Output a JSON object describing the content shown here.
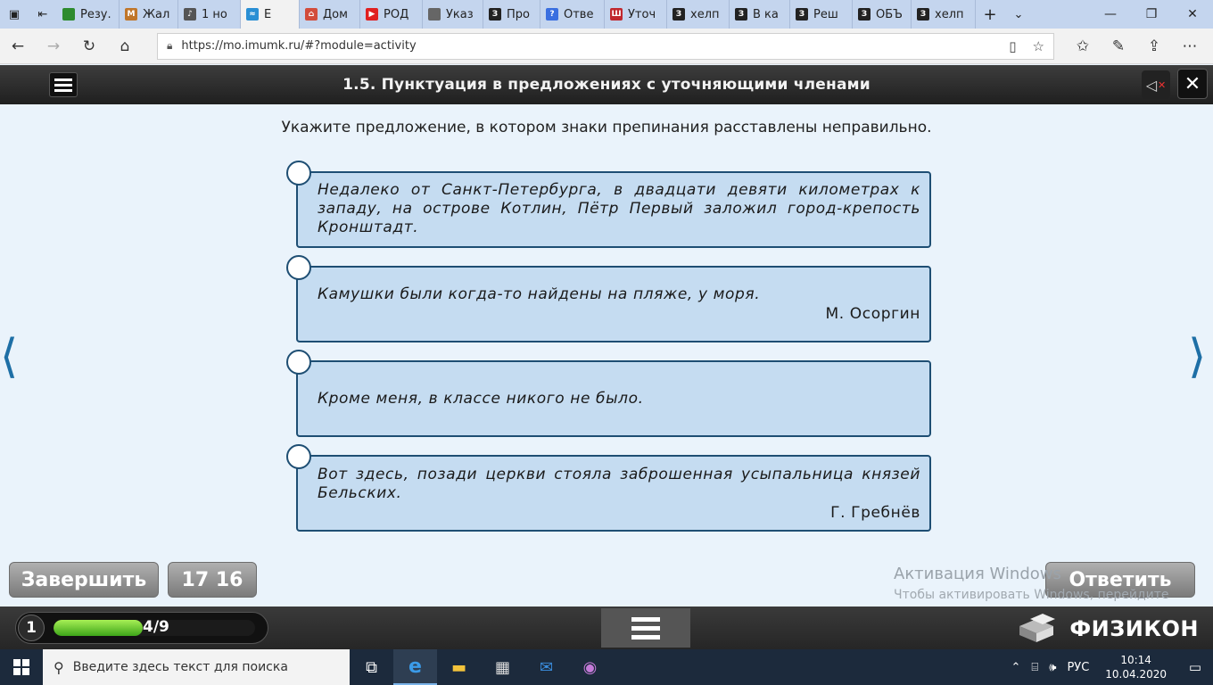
{
  "browser": {
    "tabs": [
      {
        "label": "Резу.",
        "color": "#2e8b2e",
        "glyph": ""
      },
      {
        "label": "Жал",
        "color": "#c0762a",
        "glyph": "M"
      },
      {
        "label": "1 но",
        "color": "#555555",
        "glyph": "♪"
      },
      {
        "label": "Е",
        "color": "#2a8fd4",
        "glyph": "≈"
      },
      {
        "label": "Дом",
        "color": "#d24c3b",
        "glyph": "⌂"
      },
      {
        "label": "РОД",
        "color": "#e02020",
        "glyph": "▶"
      },
      {
        "label": "Указ",
        "color": "#666666",
        "glyph": ""
      },
      {
        "label": "Про",
        "color": "#222222",
        "glyph": "З"
      },
      {
        "label": "Отве",
        "color": "#3a6fe0",
        "glyph": "?"
      },
      {
        "label": "Уточ",
        "color": "#c0282e",
        "glyph": "Ш"
      },
      {
        "label": "хелп",
        "color": "#222222",
        "glyph": "З"
      },
      {
        "label": "В ка",
        "color": "#222222",
        "glyph": "З"
      },
      {
        "label": "Реш",
        "color": "#222222",
        "glyph": "З"
      },
      {
        "label": "ОБЪ",
        "color": "#222222",
        "glyph": "З"
      },
      {
        "label": "хелп",
        "color": "#222222",
        "glyph": "З"
      }
    ],
    "url": "https://mo.imumk.ru/#?module=activity"
  },
  "app": {
    "title": "1.5. Пунктуация в предложениях с уточняющими членами",
    "question": "Укажите предложение, в котором знаки препинания расставлены неправильно.",
    "options": [
      {
        "text": "Недалеко от Санкт-Петербурга, в двадцати девяти километрах к западу, на острове Котлин, Пётр Первый заложил город-крепость Кронштадт.",
        "author": ""
      },
      {
        "text": "Камушки были когда-то найдены на пляже, у моря.",
        "author": "М. Осоргин"
      },
      {
        "text": "Кроме меня, в классе никого не было.",
        "author": ""
      },
      {
        "text": "Вот здесь, позади церкви стояла заброшенная усыпальница князей Бельских.",
        "author": "Г. Гребнёв"
      }
    ],
    "finish_label": "Завершить",
    "timer_label": "17 16",
    "answer_label": "Ответить",
    "progress": {
      "step": "1",
      "label": "4/9",
      "fraction": 0.444
    },
    "brand": "ФИЗИКОН"
  },
  "watermark": {
    "line1": "Активация Windows",
    "line2": "Чтобы активировать Windows, перейдите в раздел \"Параметры\"."
  },
  "taskbar": {
    "search_placeholder": "Введите здесь текст для поиска",
    "lang": "РУС",
    "time": "10:14",
    "date": "10.04.2020"
  }
}
